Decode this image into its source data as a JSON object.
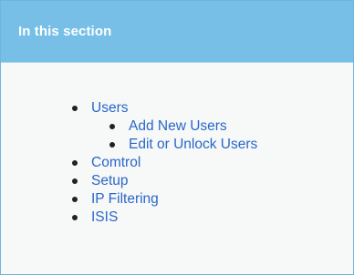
{
  "panel": {
    "title": "In this section"
  },
  "toc": {
    "items": [
      {
        "label": "Users",
        "children": [
          {
            "label": "Add New Users"
          },
          {
            "label": "Edit or Unlock Users"
          }
        ]
      },
      {
        "label": "Comtrol"
      },
      {
        "label": "Setup"
      },
      {
        "label": "IP Filtering"
      },
      {
        "label": "ISIS"
      }
    ]
  },
  "colors": {
    "header_bg": "#77bfe6",
    "border": "#6eb4dc",
    "body_bg": "#f7f8f8",
    "link": "#2a67c9",
    "title_text": "#ffffff"
  }
}
